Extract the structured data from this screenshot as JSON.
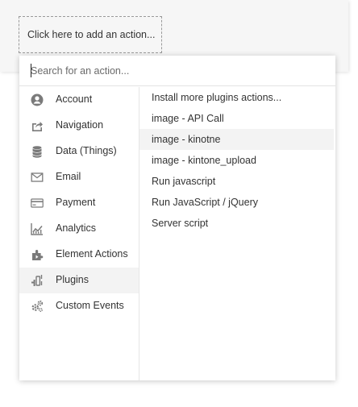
{
  "workflow": {
    "add_action_label": "Click here to add an action..."
  },
  "search": {
    "placeholder": "Search for an action...",
    "value": ""
  },
  "categories": [
    {
      "label": "Account",
      "icon": "account-icon"
    },
    {
      "label": "Navigation",
      "icon": "navigation-icon"
    },
    {
      "label": "Data (Things)",
      "icon": "database-icon"
    },
    {
      "label": "Email",
      "icon": "email-icon"
    },
    {
      "label": "Payment",
      "icon": "credit-card-icon"
    },
    {
      "label": "Analytics",
      "icon": "analytics-icon"
    },
    {
      "label": "Element Actions",
      "icon": "element-actions-icon"
    },
    {
      "label": "Plugins",
      "icon": "plugins-icon"
    },
    {
      "label": "Custom Events",
      "icon": "custom-events-icon"
    }
  ],
  "selected_category": "Plugins",
  "actions": [
    {
      "label": "Install more plugins actions..."
    },
    {
      "label": "image - API Call"
    },
    {
      "label": "image - kinotne"
    },
    {
      "label": "image - kintone_upload"
    },
    {
      "label": "Run javascript"
    },
    {
      "label": "Run JavaScript / jQuery"
    },
    {
      "label": "Server script"
    }
  ],
  "hovered_action": "image - kinotne",
  "colors": {
    "text": "#333333",
    "icon": "#7a7a7a",
    "selected_bg": "#f3f3f3",
    "panel_bg": "#f6f6f6"
  }
}
